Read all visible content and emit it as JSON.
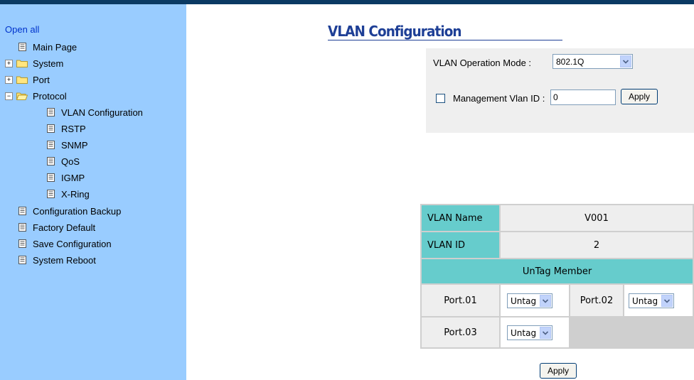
{
  "sidebar": {
    "open_all": "Open all",
    "items": [
      {
        "label": "Main Page",
        "icon": "document-icon"
      },
      {
        "label": "System",
        "icon": "folder-icon",
        "expander": "+"
      },
      {
        "label": "Port",
        "icon": "folder-icon",
        "expander": "+"
      },
      {
        "label": "Protocol",
        "icon": "folder-open-icon",
        "expander": "−"
      },
      {
        "label": "VLAN Configuration",
        "icon": "document-icon"
      },
      {
        "label": "RSTP",
        "icon": "document-icon"
      },
      {
        "label": "SNMP",
        "icon": "document-icon"
      },
      {
        "label": "QoS",
        "icon": "document-icon"
      },
      {
        "label": "IGMP",
        "icon": "document-icon"
      },
      {
        "label": "X-Ring",
        "icon": "document-icon"
      },
      {
        "label": "Configuration Backup",
        "icon": "document-icon"
      },
      {
        "label": "Factory Default",
        "icon": "document-icon"
      },
      {
        "label": "Save Configuration",
        "icon": "document-icon"
      },
      {
        "label": "System Reboot",
        "icon": "document-icon"
      }
    ]
  },
  "page": {
    "title": "VLAN Configuration"
  },
  "settings": {
    "mode_label": "VLAN Operation Mode :",
    "mode_value": "802.1Q",
    "mgmt_label": "Management Vlan ID :",
    "mgmt_checked": false,
    "mgmt_value": "0",
    "apply_label": "Apply"
  },
  "vlan": {
    "name_label": "VLAN Name",
    "name_value": "V001",
    "id_label": "VLAN ID",
    "id_value": "2",
    "untag_header": "UnTag Member",
    "ports": [
      {
        "label": "Port.01",
        "value": "Untag"
      },
      {
        "label": "Port.02",
        "value": "Untag"
      },
      {
        "label": "Port.03",
        "value": "Untag"
      }
    ],
    "apply_label": "Apply"
  },
  "colors": {
    "sidebar_bg": "#99ccff",
    "title": "#1e3f96",
    "table_header": "#66cccc",
    "top_bar": "#0b3a63"
  }
}
